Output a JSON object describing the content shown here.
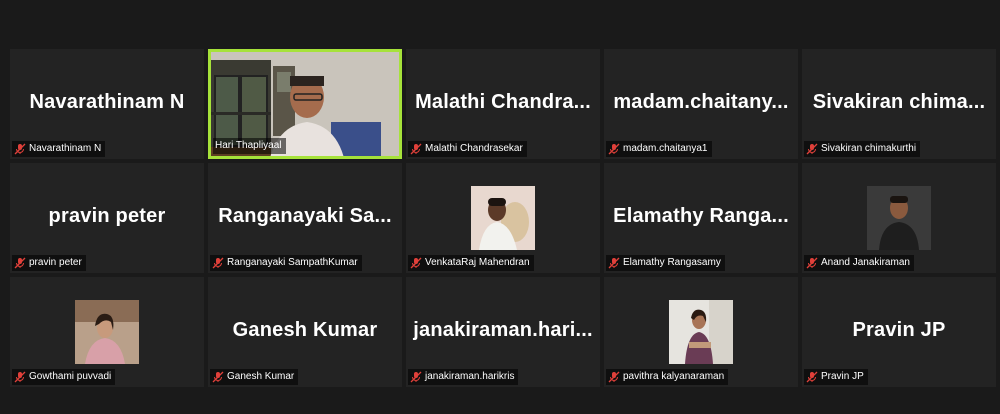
{
  "colors": {
    "speaking_border": "#a6e23a",
    "muted_mic": "#e0403a",
    "tile_bg": "#232323"
  },
  "tiles": [
    {
      "big_name": "Navarathinam N",
      "label": "Navarathinam N"
    },
    {
      "big_name": "",
      "label": "Hari Thapliyaal"
    },
    {
      "big_name": "Malathi  Chandra...",
      "label": "Malathi Chandrasekar"
    },
    {
      "big_name": "madam.chaitany...",
      "label": "madam.chaitanya1"
    },
    {
      "big_name": "Sivakiran  chima...",
      "label": "Sivakiran chimakurthi"
    },
    {
      "big_name": "pravin peter",
      "label": "pravin peter"
    },
    {
      "big_name": "Ranganayaki  Sa...",
      "label": "Ranganayaki SampathKumar"
    },
    {
      "big_name": "",
      "label": "VenkataRaj Mahendran"
    },
    {
      "big_name": "Elamathy  Ranga...",
      "label": "Elamathy Rangasamy"
    },
    {
      "big_name": "",
      "label": "Anand Janakiraman"
    },
    {
      "big_name": "",
      "label": "Gowthami puvvadi"
    },
    {
      "big_name": "Ganesh Kumar",
      "label": "Ganesh Kumar"
    },
    {
      "big_name": "janakiraman.hari...",
      "label": "janakiraman.harikris"
    },
    {
      "big_name": "",
      "label": "pavithra kalyanaraman"
    },
    {
      "big_name": "Pravin JP",
      "label": "Pravin JP"
    }
  ]
}
